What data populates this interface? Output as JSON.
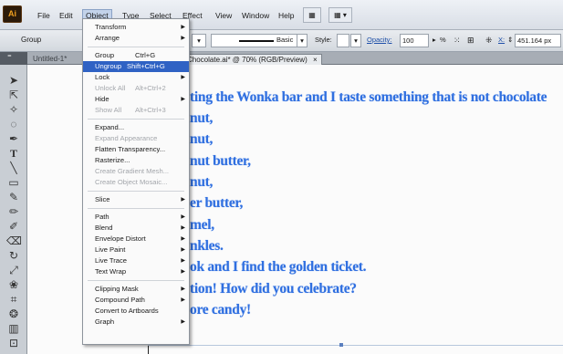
{
  "app": {
    "logo": "Ai"
  },
  "menubar": {
    "items": [
      "File",
      "Edit",
      "Object",
      "Type",
      "Select",
      "Effect",
      "View",
      "Window",
      "Help"
    ]
  },
  "controlbar": {
    "selection_label": "Group",
    "stroke_style": "Basic",
    "style_label": "Style:",
    "opacity_label": "Opacity:",
    "opacity_value": "100",
    "percent": "%",
    "width_value": "451.164 px"
  },
  "tabs": {
    "inactive": "Untitled-1*",
    "current": "Chocolate.ai* @ 70% (RGB/Preview)",
    "close": "×"
  },
  "object_menu": {
    "items": [
      {
        "label": "Transform",
        "submenu": true
      },
      {
        "label": "Arrange",
        "submenu": true
      },
      {
        "label": "Group",
        "shortcut": "Ctrl+G"
      },
      {
        "label": "Ungroup",
        "shortcut": "Shift+Ctrl+G"
      },
      {
        "label": "Lock",
        "submenu": true
      },
      {
        "label": "Unlock All",
        "shortcut": "Alt+Ctrl+2",
        "disabled": true
      },
      {
        "label": "Hide",
        "submenu": true
      },
      {
        "label": "Show All",
        "shortcut": "Alt+Ctrl+3",
        "disabled": true
      },
      {
        "label": "Expand..."
      },
      {
        "label": "Expand Appearance",
        "disabled": true
      },
      {
        "label": "Flatten Transparency..."
      },
      {
        "label": "Rasterize..."
      },
      {
        "label": "Create Gradient Mesh...",
        "disabled": true
      },
      {
        "label": "Create Object Mosaic...",
        "disabled": true
      },
      {
        "label": "Slice",
        "submenu": true
      },
      {
        "label": "Path",
        "submenu": true
      },
      {
        "label": "Blend",
        "submenu": true
      },
      {
        "label": "Envelope Distort",
        "submenu": true
      },
      {
        "label": "Live Paint",
        "submenu": true
      },
      {
        "label": "Live Trace",
        "submenu": true
      },
      {
        "label": "Text Wrap",
        "submenu": true
      },
      {
        "label": "Clipping Mask",
        "submenu": true
      },
      {
        "label": "Compound Path",
        "submenu": true
      },
      {
        "label": "Convert to Artboards"
      },
      {
        "label": "Graph",
        "submenu": true
      }
    ],
    "highlighted": "Ungroup"
  },
  "canvas_text": [
    "ting the Wonka bar and I taste something that is not chocolate",
    "nut,",
    "nut,",
    "nut butter,",
    "nut,",
    "er butter,",
    "mel,",
    "nkles.",
    "ok and I find the golden ticket.",
    "tion! How did you celebrate?",
    "ore candy!"
  ],
  "colors": {
    "text_accent": "#2f6fe0",
    "menu_highlight": "#2f62c4"
  }
}
